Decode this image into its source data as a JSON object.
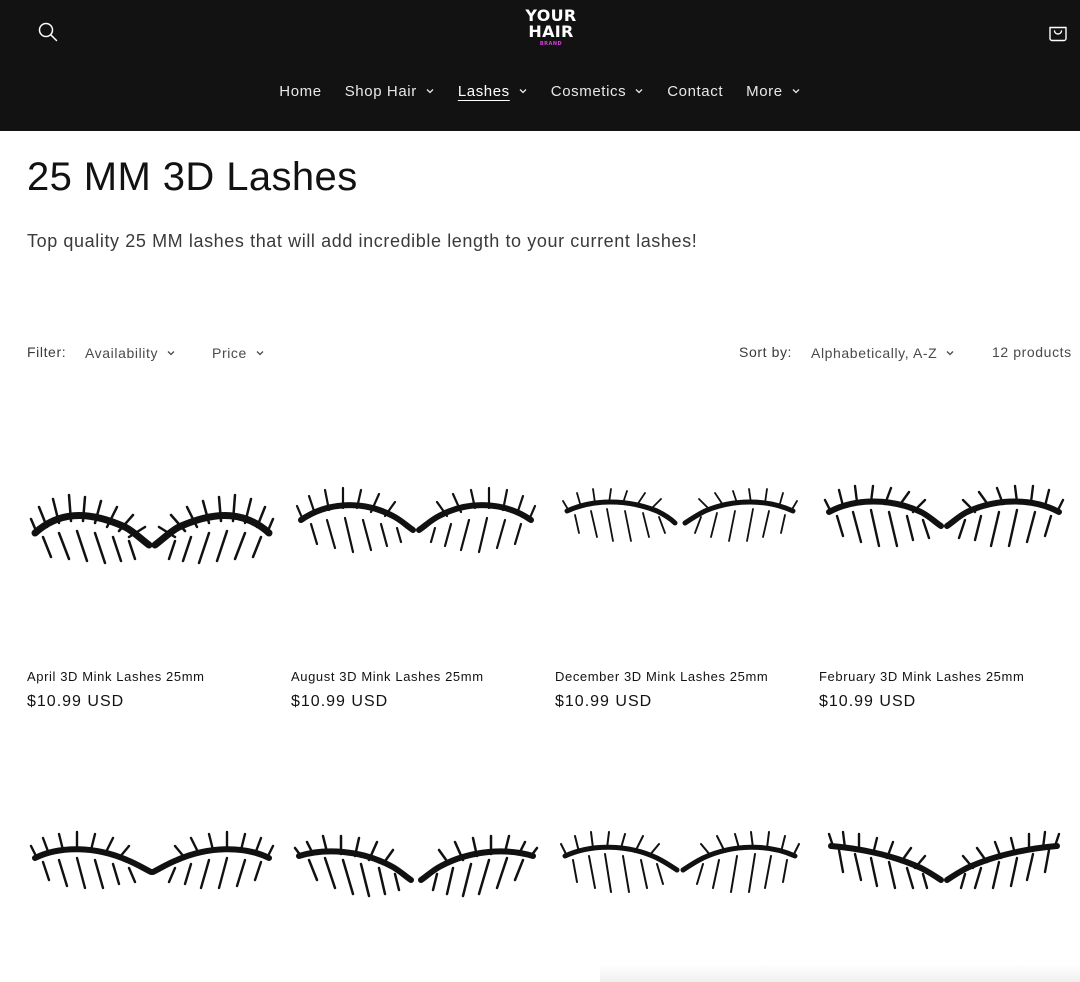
{
  "header": {
    "logo": {
      "line1": "YOUR",
      "line2": "HAIR",
      "line3": "BRAND"
    },
    "icons": {
      "search": "search-icon",
      "cart": "cart-icon"
    },
    "nav": [
      {
        "label": "Home",
        "dropdown": false,
        "active": false
      },
      {
        "label": "Shop Hair",
        "dropdown": true,
        "active": false
      },
      {
        "label": "Lashes",
        "dropdown": true,
        "active": true
      },
      {
        "label": "Cosmetics",
        "dropdown": true,
        "active": false
      },
      {
        "label": "Contact",
        "dropdown": false,
        "active": false
      },
      {
        "label": "More",
        "dropdown": true,
        "active": false
      }
    ],
    "colors": {
      "background": "#121212",
      "logo_accent": "#d63ae0"
    }
  },
  "collection": {
    "title": "25 MM 3D Lashes",
    "description": "Top quality 25 MM lashes that will add incredible length to your current lashes!"
  },
  "filters": {
    "label": "Filter:",
    "availability": "Availability",
    "price": "Price",
    "sort_label": "Sort by:",
    "sort_value": "Alphabetically, A-Z",
    "count": "12 products"
  },
  "products": [
    {
      "title": "April 3D Mink Lashes 25mm",
      "price": "$10.99 USD"
    },
    {
      "title": "August 3D Mink Lashes 25mm",
      "price": "$10.99 USD"
    },
    {
      "title": "December 3D Mink Lashes 25mm",
      "price": "$10.99 USD"
    },
    {
      "title": "February 3D Mink Lashes 25mm",
      "price": "$10.99 USD"
    },
    {
      "title": "",
      "price": ""
    },
    {
      "title": "",
      "price": ""
    },
    {
      "title": "",
      "price": ""
    },
    {
      "title": "",
      "price": ""
    }
  ]
}
